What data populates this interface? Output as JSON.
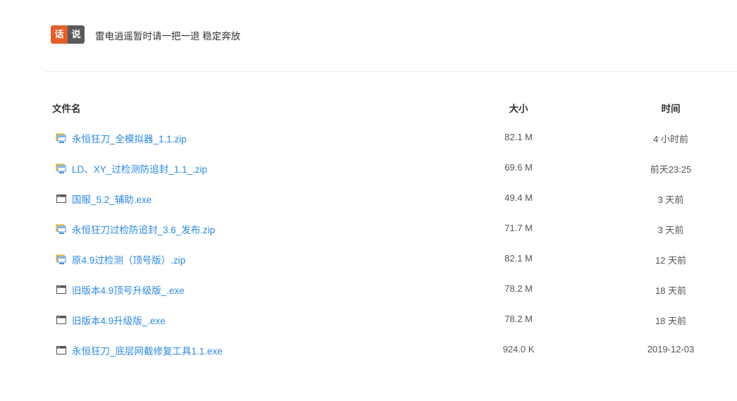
{
  "notice": {
    "badge_left": "话",
    "badge_right": "说",
    "text": "雷电逍遥暂时请一把一退 稳定奔放"
  },
  "table": {
    "headers": {
      "name": "文件名",
      "size": "大小",
      "time": "时间"
    },
    "rows": [
      {
        "name": "永恒狂刀_全模拟器_1.1.zip",
        "size": "82.1 M",
        "time": "4 小时前",
        "icon": "zip-file-icon"
      },
      {
        "name": "LD、XY_过检测防追封_1.1_.zip",
        "size": "69.6 M",
        "time": "前天23:25",
        "icon": "zip-file-icon"
      },
      {
        "name": "国服_5.2_辅助.exe",
        "size": "49.4 M",
        "time": "3 天前",
        "icon": "exe-file-icon"
      },
      {
        "name": "永恒狂刀过检防追封_3.6_发布.zip",
        "size": "71.7 M",
        "time": "3 天前",
        "icon": "zip-file-icon"
      },
      {
        "name": "原4.9过检测（顶号版）.zip",
        "size": "82.1 M",
        "time": "12 天前",
        "icon": "zip-file-icon"
      },
      {
        "name": "旧版本4.9顶号升级版_.exe",
        "size": "78.2 M",
        "time": "18 天前",
        "icon": "exe-file-icon"
      },
      {
        "name": "旧版本4.9升级版_.exe",
        "size": "78.2 M",
        "time": "18 天前",
        "icon": "exe-file-icon"
      },
      {
        "name": "永恒狂刀_底层网截修复工具1.1.exe",
        "size": "924.0 K",
        "time": "2019-12-03",
        "icon": "exe-file-icon"
      }
    ]
  }
}
